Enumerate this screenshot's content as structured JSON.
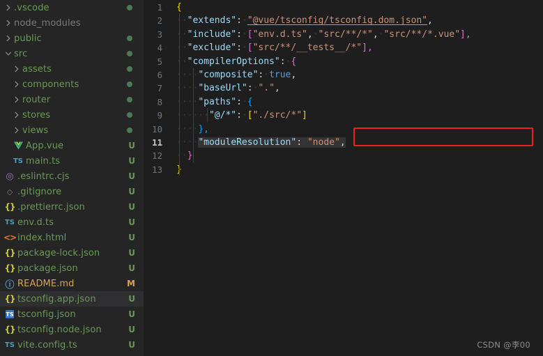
{
  "explorer": {
    "items": [
      {
        "label": ".vscode",
        "kind": "folder",
        "expanded": false,
        "depth": 0,
        "color": "#6a9955",
        "icon": "chevron-right-icon",
        "status": "dot"
      },
      {
        "label": "node_modules",
        "kind": "folder",
        "expanded": false,
        "depth": 0,
        "color": "#7a7a7a",
        "icon": "chevron-right-icon",
        "status": ""
      },
      {
        "label": "public",
        "kind": "folder",
        "expanded": false,
        "depth": 0,
        "color": "#6a9955",
        "icon": "chevron-right-icon",
        "status": "dot"
      },
      {
        "label": "src",
        "kind": "folder",
        "expanded": true,
        "depth": 0,
        "color": "#6a9955",
        "icon": "chevron-down-icon",
        "status": "dot"
      },
      {
        "label": "assets",
        "kind": "folder",
        "expanded": false,
        "depth": 1,
        "color": "#6a9955",
        "icon": "chevron-right-icon",
        "status": "dot"
      },
      {
        "label": "components",
        "kind": "folder",
        "expanded": false,
        "depth": 1,
        "color": "#6a9955",
        "icon": "chevron-right-icon",
        "status": "dot"
      },
      {
        "label": "router",
        "kind": "folder",
        "expanded": false,
        "depth": 1,
        "color": "#6a9955",
        "icon": "chevron-right-icon",
        "status": "dot"
      },
      {
        "label": "stores",
        "kind": "folder",
        "expanded": false,
        "depth": 1,
        "color": "#6a9955",
        "icon": "chevron-right-icon",
        "status": "dot"
      },
      {
        "label": "views",
        "kind": "folder",
        "expanded": false,
        "depth": 1,
        "color": "#6a9955",
        "icon": "chevron-right-icon",
        "status": "dot"
      },
      {
        "label": "App.vue",
        "kind": "file",
        "depth": 1,
        "color": "#6a9955",
        "icon": "vue-file-icon",
        "status": "U"
      },
      {
        "label": "main.ts",
        "kind": "file",
        "depth": 1,
        "color": "#6a9955",
        "icon": "typescript-file-icon",
        "status": "U"
      },
      {
        "label": ".eslintrc.cjs",
        "kind": "file",
        "depth": 0,
        "color": "#6a9955",
        "icon": "eslint-file-icon",
        "status": "U"
      },
      {
        "label": ".gitignore",
        "kind": "file",
        "depth": 0,
        "color": "#6a9955",
        "icon": "git-file-icon",
        "status": "U"
      },
      {
        "label": ".prettierrc.json",
        "kind": "file",
        "depth": 0,
        "color": "#6a9955",
        "icon": "json-file-icon",
        "status": "U"
      },
      {
        "label": "env.d.ts",
        "kind": "file",
        "depth": 0,
        "color": "#6a9955",
        "icon": "typescript-file-icon",
        "status": "U"
      },
      {
        "label": "index.html",
        "kind": "file",
        "depth": 0,
        "color": "#6a9955",
        "icon": "html-file-icon",
        "status": "U"
      },
      {
        "label": "package-lock.json",
        "kind": "file",
        "depth": 0,
        "color": "#6a9955",
        "icon": "json-file-icon",
        "status": "U"
      },
      {
        "label": "package.json",
        "kind": "file",
        "depth": 0,
        "color": "#6a9955",
        "icon": "json-file-icon",
        "status": "U"
      },
      {
        "label": "README.md",
        "kind": "file",
        "depth": 0,
        "color": "#d7a355",
        "icon": "markdown-file-icon",
        "status": "M"
      },
      {
        "label": "tsconfig.app.json",
        "kind": "file",
        "depth": 0,
        "color": "#6a9955",
        "icon": "json-file-icon",
        "status": "U",
        "selected": true
      },
      {
        "label": "tsconfig.json",
        "kind": "file",
        "depth": 0,
        "color": "#6a9955",
        "icon": "tsconfig-file-icon",
        "status": "U"
      },
      {
        "label": "tsconfig.node.json",
        "kind": "file",
        "depth": 0,
        "color": "#6a9955",
        "icon": "json-file-icon",
        "status": "U"
      },
      {
        "label": "vite.config.ts",
        "kind": "file",
        "depth": 0,
        "color": "#6a9955",
        "icon": "typescript-file-icon",
        "status": "U"
      }
    ],
    "status_colors": {
      "untracked": "#6a9955",
      "modified": "#d7a355",
      "dot": "#4b7a55"
    }
  },
  "editor": {
    "active_line": 11,
    "line_numbers": [
      "1",
      "2",
      "3",
      "4",
      "5",
      "6",
      "7",
      "8",
      "9",
      "10",
      "11",
      "12",
      "13"
    ],
    "lines": [
      {
        "n": "1",
        "text": "{"
      },
      {
        "n": "2",
        "text": "  \"extends\": \"@vue/tsconfig/tsconfig.dom.json\","
      },
      {
        "n": "3",
        "text": "  \"include\": [\"env.d.ts\", \"src/**/*\", \"src/**/*.vue\"],"
      },
      {
        "n": "4",
        "text": "  \"exclude\": [\"src/**/__tests__/*\"],"
      },
      {
        "n": "5",
        "text": "  \"compilerOptions\": {"
      },
      {
        "n": "6",
        "text": "    \"composite\": true,"
      },
      {
        "n": "7",
        "text": "    \"baseUrl\": \".\","
      },
      {
        "n": "8",
        "text": "    \"paths\": {"
      },
      {
        "n": "9",
        "text": "      \"@/*\": [\"./src/*\"]"
      },
      {
        "n": "10",
        "text": "    },"
      },
      {
        "n": "11",
        "text": "    \"moduleResolution\": \"node\","
      },
      {
        "n": "12",
        "text": "  }"
      },
      {
        "n": "13",
        "text": "}"
      }
    ],
    "tokens": {
      "extends_key": "\"extends\"",
      "extends_val": "\"@vue/tsconfig/tsconfig.dom.json\"",
      "include_key": "\"include\"",
      "include_v1": "\"env.d.ts\"",
      "include_v2": "\"src/**/*\"",
      "include_v3": "\"src/**/*.vue\"",
      "exclude_key": "\"exclude\"",
      "exclude_v1": "\"src/**/__tests__/*\"",
      "compileropts_key": "\"compilerOptions\"",
      "composite_key": "\"composite\"",
      "composite_val": "true",
      "baseurl_key": "\"baseUrl\"",
      "baseurl_val": "\".\"",
      "paths_key": "\"paths\"",
      "alias_key": "\"@/*\"",
      "alias_val": "\"./src/*\"",
      "moduleres_key": "\"moduleResolution\"",
      "moduleres_val": "\"node\"",
      "comma": ",",
      "colon": ":",
      "brace_open": "{",
      "brace_close": "}",
      "brace_close_comma": "},",
      "bracket_open": "[",
      "bracket_close": "]",
      "bracket_close_comma": "],"
    },
    "annotation": {
      "shape": "rectangle",
      "color": "#f01f1f",
      "target_line": "11",
      "target_text": "\"moduleResolution\": \"node\","
    }
  },
  "watermark": {
    "text": "CSDN @李00"
  },
  "theme": {
    "editor_bg": "#1e1e1e",
    "sidebar_bg": "#252526",
    "selected_row_bg": "#2f2f31",
    "key_color": "#9cdcfe",
    "string_color": "#ce9178",
    "boolean_color": "#569cd6",
    "punctuation_color": "#d4d4d4",
    "line_number_color": "#6e7681",
    "line_number_active_color": "#c6c6c6"
  }
}
